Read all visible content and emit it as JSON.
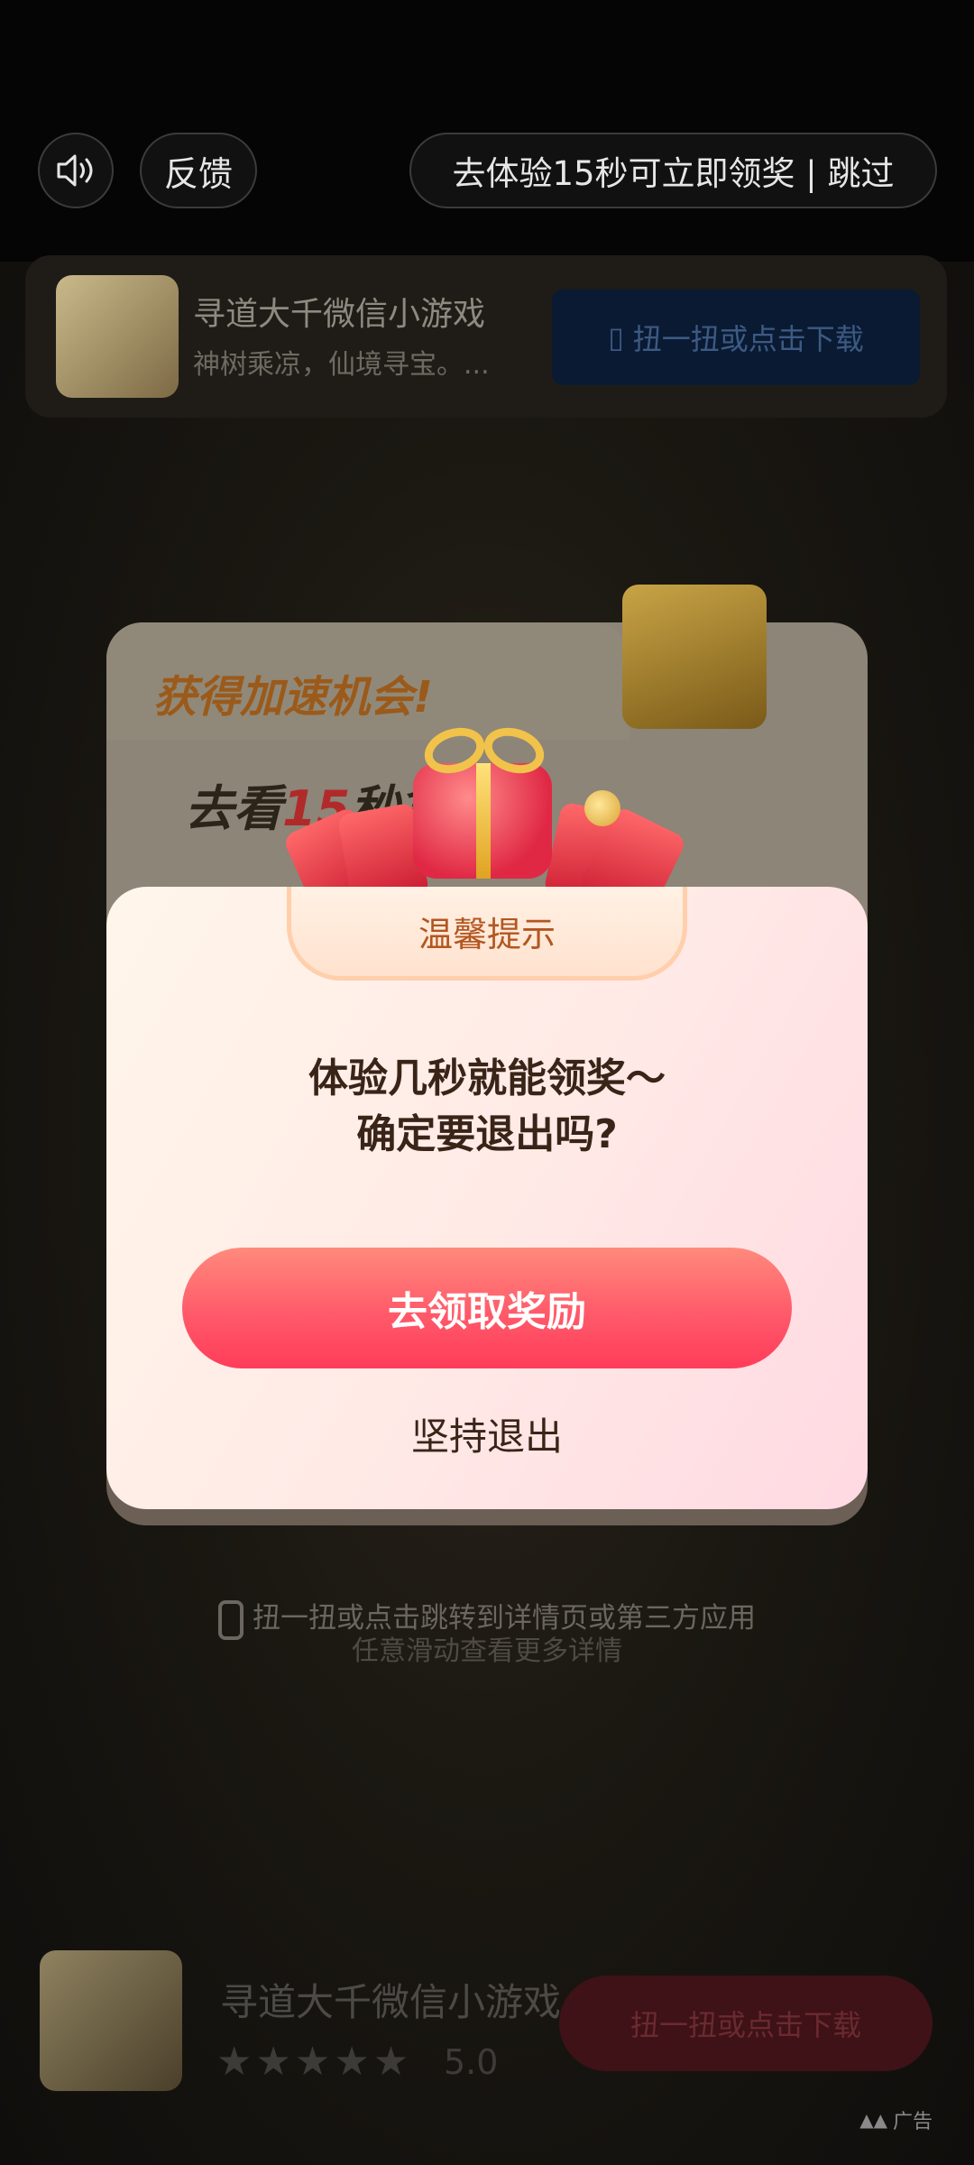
{
  "top_bar": {
    "feedback_label": "反馈",
    "skip_label": "去体验15秒可立即领奖 | 跳过"
  },
  "app_card": {
    "title": "寻道大千微信小游戏",
    "description": "神树乘凉，仙境寻宝。...",
    "download_label": "扭一扭或点击下载"
  },
  "promo": {
    "headline": "获得加速机会!",
    "sub_prefix": "去看",
    "sub_highlight": "15",
    "sub_suffix": "秒拿奖励"
  },
  "dialog": {
    "title": "温馨提示",
    "message_line1": "体验几秒就能领奖～",
    "message_line2": "确定要退出吗?",
    "claim_label": "去领取奖励",
    "exit_label": "坚持退出"
  },
  "hints": {
    "line1": "扭一扭或点击跳转到详情页或第三方应用",
    "line2": "任意滑动查看更多详情"
  },
  "bottom_card": {
    "title": "寻道大千微信小游戏",
    "stars": "★★★★★",
    "rating": "5.0",
    "download_label": "扭一扭或点击下载"
  },
  "ad_tag": "广告",
  "colors": {
    "accent_red": "#ff4a62",
    "dialog_text": "#3a2418",
    "tab_text": "#b35620"
  }
}
